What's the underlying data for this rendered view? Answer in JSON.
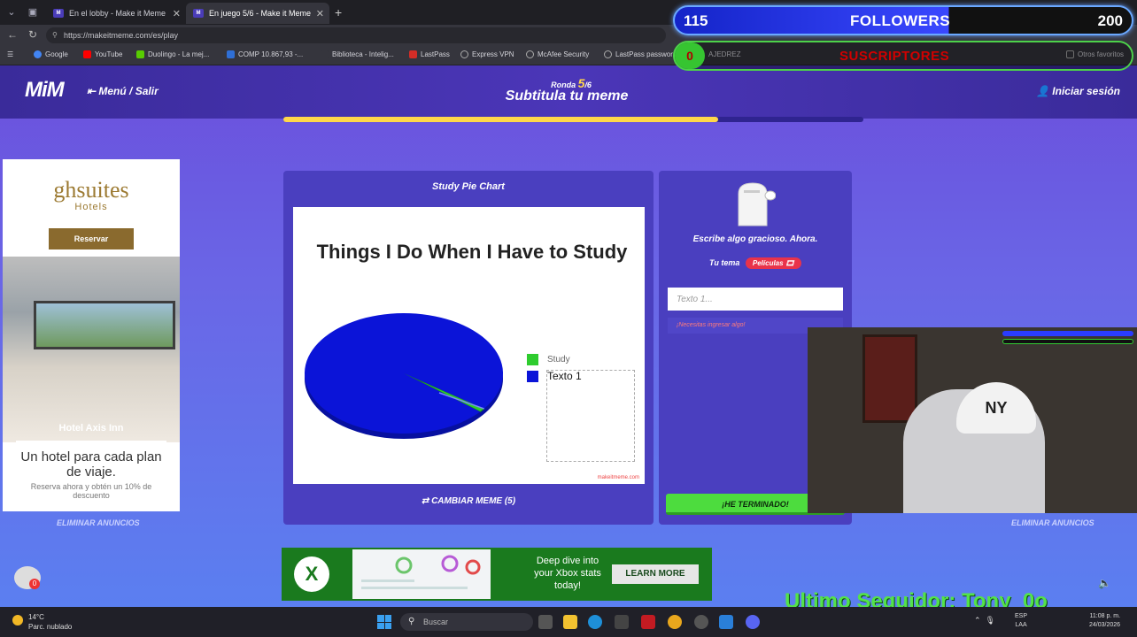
{
  "browser": {
    "tabs": [
      {
        "title": "En el lobby - Make it Meme",
        "active": false
      },
      {
        "title": "En juego 5/6 - Make it Meme",
        "active": true
      }
    ],
    "url": "https://makeitmeme.com/es/play",
    "bookmarks": [
      {
        "label": "Google",
        "color": "#4285f4"
      },
      {
        "label": "YouTube",
        "color": "#ff0000"
      },
      {
        "label": "Duolingo - La mej...",
        "color": "#58cc02"
      },
      {
        "label": "COMP 10.867,93 -...",
        "color": "#2f6fd6"
      },
      {
        "label": "Biblioteca - Intelig...",
        "color": "#666666"
      },
      {
        "label": "LastPass",
        "color": "#d32d27"
      },
      {
        "label": "Express VPN",
        "color": "#888888"
      },
      {
        "label": "McAfee Security",
        "color": "#888888"
      },
      {
        "label": "LastPass passwor...",
        "color": "#888888"
      },
      {
        "label": "AJEDREZ",
        "color": "#888888"
      },
      {
        "label": "Otros favoritos",
        "color": "#888888"
      }
    ]
  },
  "site": {
    "logo": "MiM",
    "menu_label": "Menú / Salir",
    "round_label": "Ronda",
    "round_current": "5",
    "round_total": "/6",
    "phase_title": "Subtitula tu meme",
    "login_label": "Iniciar sesión",
    "timer_fraction": 0.75
  },
  "ad_left": {
    "brand": "ghsuites",
    "brand_sub": "Hotels",
    "reserve_label": "Reservar",
    "hotel_name": "Hotel Axis Inn",
    "tagline": "Un hotel para cada plan de viaje.",
    "subline": "Reserva ahora y obtén un 10% de descuento",
    "remove_ads": "ELIMINAR ANUNCIOS"
  },
  "meme": {
    "title": "Study Pie Chart",
    "change_label": "CAMBIAR MEME (5)",
    "watermark": "makeitmeme.com",
    "chart_data": {
      "type": "pie",
      "title": "Things I Do When I Have to Study",
      "categories": [
        "Study",
        "Texto 1"
      ],
      "values": [
        1,
        99
      ],
      "colors": [
        "#2ecc2e",
        "#0b14d8"
      ],
      "legend": "right"
    }
  },
  "caption": {
    "prompt": "Escribe algo gracioso. Ahora.",
    "theme_label": "Tu tema",
    "theme_value": "Películas",
    "input_placeholder": "Texto 1...",
    "error_text": "¡Necesitas ingresar algo!",
    "done_label": "¡HE TERMINADO!",
    "remove_ads": "ELIMINAR ANUNCIOS"
  },
  "ad_bottom": {
    "logo": "X",
    "copy": "Deep dive into your Xbox stats today!",
    "cta": "LEARN MORE"
  },
  "chat": {
    "badge": "0"
  },
  "overlay": {
    "followers_count": "115",
    "followers_label": "FOLLOWERS",
    "followers_goal": "200",
    "subs_count": "0",
    "subs_label": "SUSCRIPTORES",
    "last_follower": "Ultimo Seguidor: Tony_0o"
  },
  "taskbar": {
    "weather_temp": "14°C",
    "weather_desc": "Parc. nublado",
    "search_placeholder": "Buscar",
    "lang1": "ESP",
    "lang2": "LAA",
    "time": "11:08 p. m.",
    "date": "24/03/2026"
  }
}
